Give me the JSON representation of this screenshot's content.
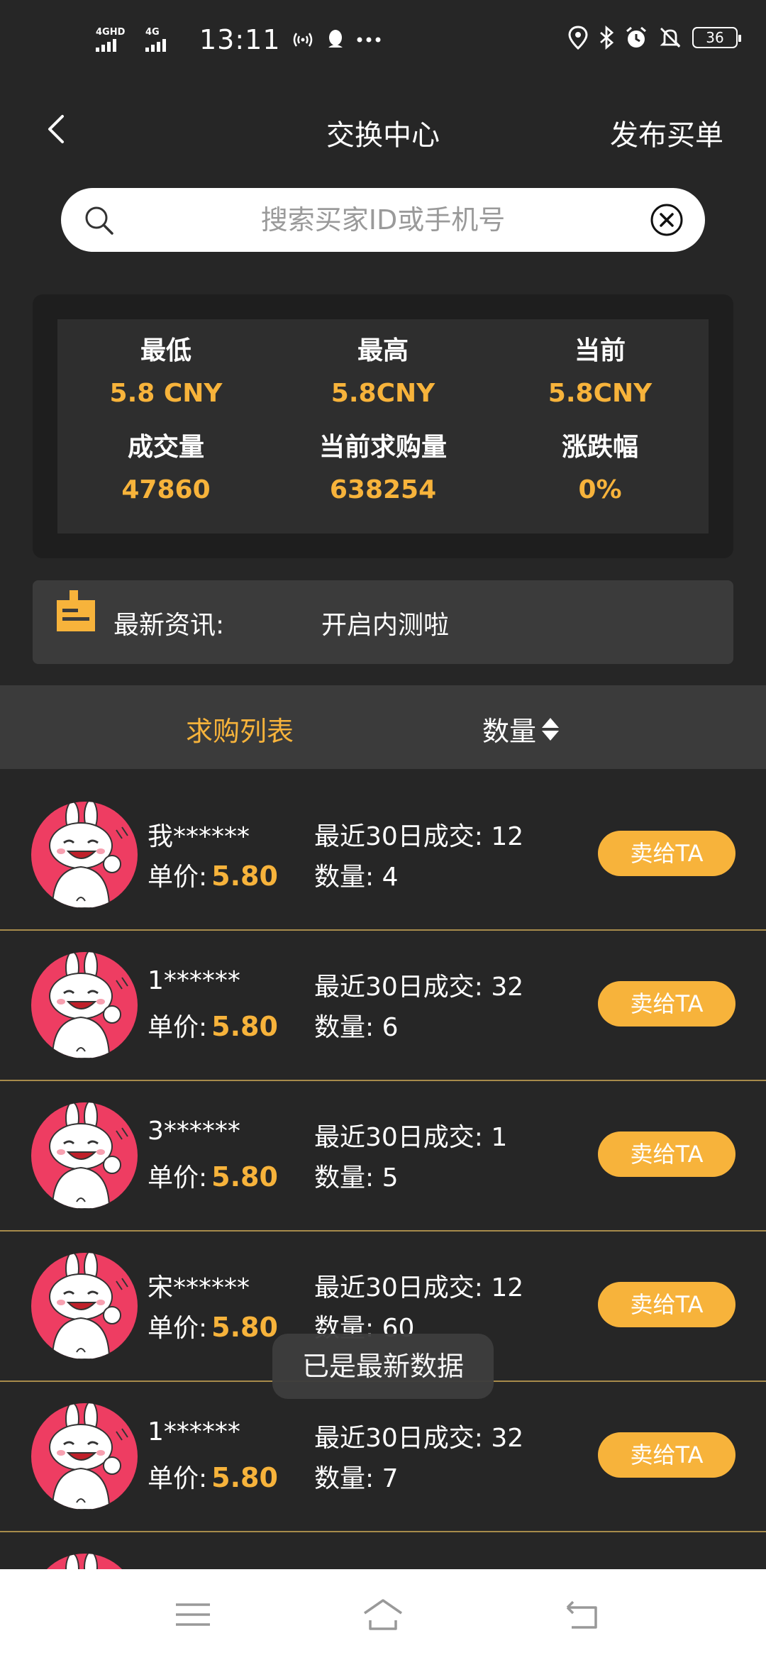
{
  "status_bar": {
    "net1": "4GHD",
    "net2": "4G",
    "time": "13:11",
    "battery": "36"
  },
  "header": {
    "title": "交换中心",
    "action": "发布买单"
  },
  "search": {
    "placeholder": "搜索买家ID或手机号"
  },
  "stats": {
    "low_label": "最低",
    "low_value": "5.8 CNY",
    "high_label": "最高",
    "high_value": "5.8CNY",
    "current_label": "当前",
    "current_value": "5.8CNY",
    "volume_label": "成交量",
    "volume_value": "47860",
    "demand_label": "当前求购量",
    "demand_value": "638254",
    "change_label": "涨跌幅",
    "change_value": "0%"
  },
  "news": {
    "label": "最新资讯:",
    "text": "开启内测啦"
  },
  "tabs": {
    "list_label": "求购列表",
    "qty_label": "数量"
  },
  "listing": {
    "price_label": "单价:",
    "deals_label": "最近30日成交:",
    "qty_label": "数量:",
    "sell_label": "卖给TA",
    "rows": [
      {
        "name": "我******",
        "price": "5.80",
        "deals": "12",
        "qty": "4"
      },
      {
        "name": "1******",
        "price": "5.80",
        "deals": "32",
        "qty": "6"
      },
      {
        "name": "3******",
        "price": "5.80",
        "deals": "1",
        "qty": "5"
      },
      {
        "name": "宋******",
        "price": "5.80",
        "deals": "12",
        "qty": "60"
      },
      {
        "name": "1******",
        "price": "5.80",
        "deals": "32",
        "qty": "7"
      }
    ]
  },
  "toast": "已是最新数据",
  "colors": {
    "accent": "#f7b33b",
    "background": "#262626",
    "avatar": "#ee3d62"
  }
}
